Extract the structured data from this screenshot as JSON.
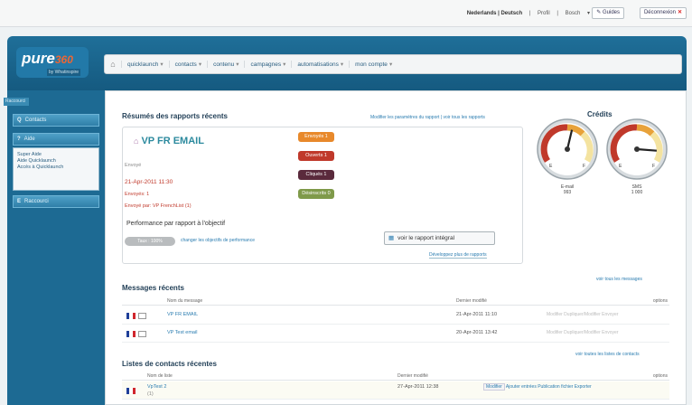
{
  "topbar": {
    "language": "Nederlands | Deutsch",
    "profile": "Profil",
    "user": "Bosch",
    "help_label": "Guides",
    "logout_label": "Déconnexion",
    "logout_icon": "close-icon"
  },
  "brand": {
    "logo_text": "pure",
    "logo_number": "360",
    "logo_sub": "by Whatinspire"
  },
  "nav": {
    "items": [
      {
        "label": "quicklaunch"
      },
      {
        "label": "contacts"
      },
      {
        "label": "contenu"
      },
      {
        "label": "campagnes"
      },
      {
        "label": "automatisations"
      },
      {
        "label": "mon compte"
      }
    ]
  },
  "sidebar": {
    "section_label": "Raccourci",
    "buttons": [
      {
        "label": "Contacts",
        "icon": "Q"
      },
      {
        "label": "Aide",
        "icon": "?"
      },
      {
        "label": "Raccourci",
        "icon": "E"
      }
    ],
    "help_links": [
      "Super Aide",
      "Aide Quicklaunch",
      "Accès à Quicklaunch"
    ]
  },
  "reports": {
    "title": "Résumés des rapports récents",
    "settings_link": "Modifier les paramètres du rapport | voir tous les rapports",
    "name": "VP FR EMAIL",
    "status": "Envoyé",
    "date": "21-Apr-2011 11:30",
    "sent": "Envoyés: 1",
    "sender": "Envoyé par: VP FrenchList (1)",
    "badges": [
      {
        "label": "Envoyés 1",
        "color": "#e8892b"
      },
      {
        "label": "Ouverts 1",
        "color": "#c0392b"
      },
      {
        "label": "Cliqués 1",
        "color": "#5a2a3c"
      },
      {
        "label": "Désinscrits 0",
        "color": "#7f9a4a"
      }
    ],
    "performance_title": "Performance par rapport à l'objectif",
    "pill": "Taux : 100%",
    "perf_link": "changer les objectifs de performance",
    "full_report_button": "voir le rapport intégral",
    "more_link": "Développez plus de rapports"
  },
  "credits": {
    "title": "Crédits",
    "gauges": [
      {
        "name": "E-mail",
        "value": "993",
        "level": 0.55
      },
      {
        "name": "SMS",
        "value": "1 000",
        "level": 0.85
      }
    ]
  },
  "messages": {
    "title": "Messages récents",
    "view_all": "voir tous les messages",
    "col_name": "Nom du message",
    "col_date": "Dernier modifié",
    "col_options": "options",
    "rows": [
      {
        "name": "VP FR EMAIL",
        "date": "21-Apr-2011 11:10",
        "actions": "Modifier   Dupliquer/Modifier   Envoyer"
      },
      {
        "name": "VP Test email",
        "date": "20-Apr-2011 13:42",
        "actions": "Modifier   Dupliquer/Modifier   Envoyer"
      }
    ]
  },
  "contacts": {
    "title": "Listes de contacts récentes",
    "view_all": "voir toutes les listes de contacts",
    "col_name": "Nom de liste",
    "col_date": "Dernier modifié",
    "col_options": "options",
    "rows": [
      {
        "name": "VpTest 2",
        "sub": "(1)",
        "date": "27-Apr-2011 12:38",
        "btn": "Modifier",
        "actions": "Ajouter entrées   Publication fichier   Exporter"
      }
    ]
  },
  "colors": {
    "brand": "#1a6690",
    "link": "#2a7cb0",
    "title": "#2c8a9e"
  }
}
